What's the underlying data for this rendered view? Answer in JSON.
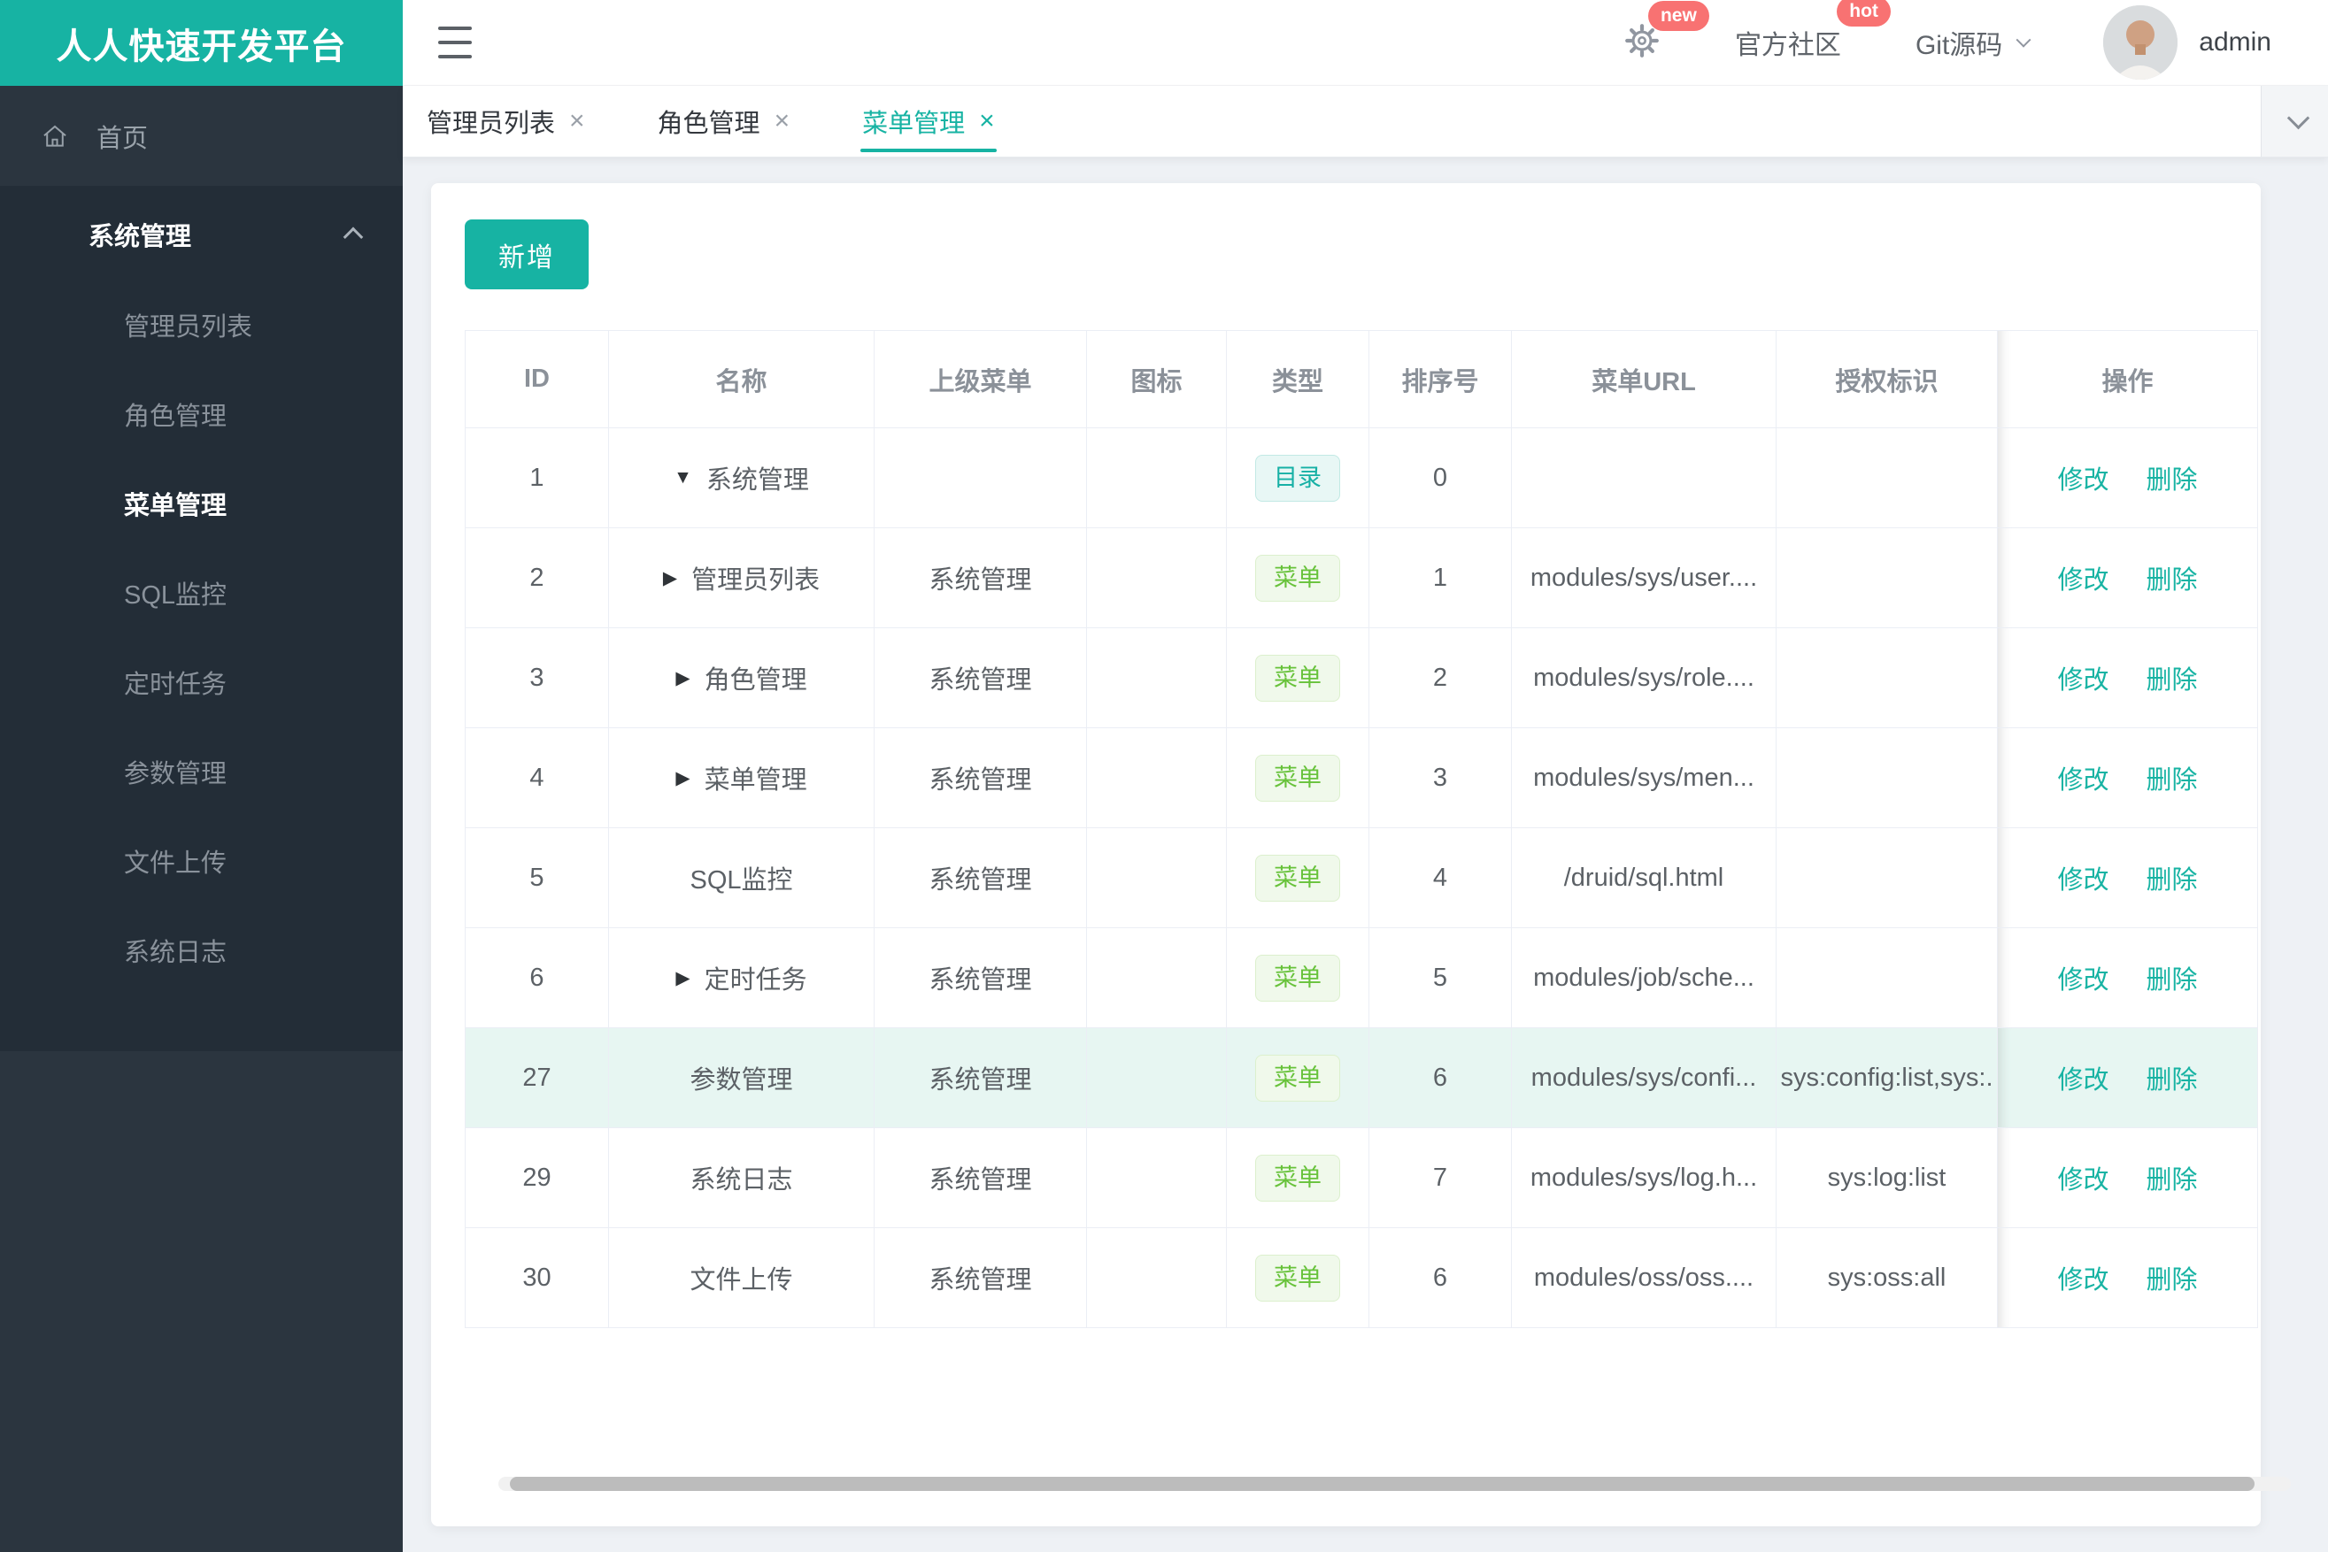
{
  "app": {
    "sidebar_logo": "人人快速开发平台"
  },
  "icons": {
    "close": "×",
    "tree_expanded": "▼",
    "tree_collapsed": "▶"
  },
  "colors": {
    "primary": "#17b3a3",
    "badge_red": "#f87272"
  },
  "sidebar": {
    "home_label": "首页",
    "section_label": "系统管理",
    "items": [
      {
        "label": "管理员列表",
        "active": false
      },
      {
        "label": "角色管理",
        "active": false
      },
      {
        "label": "菜单管理",
        "active": true
      },
      {
        "label": "SQL监控",
        "active": false
      },
      {
        "label": "定时任务",
        "active": false
      },
      {
        "label": "参数管理",
        "active": false
      },
      {
        "label": "文件上传",
        "active": false
      },
      {
        "label": "系统日志",
        "active": false
      }
    ]
  },
  "header": {
    "settings_badge": "new",
    "community_label": "官方社区",
    "community_badge": "hot",
    "git_label": "Git源码",
    "username": "admin"
  },
  "tabs": [
    {
      "label": "管理员列表",
      "active": false
    },
    {
      "label": "角色管理",
      "active": false
    },
    {
      "label": "菜单管理",
      "active": true
    }
  ],
  "toolbar": {
    "add_label": "新增"
  },
  "table": {
    "columns": [
      "ID",
      "名称",
      "上级菜单",
      "图标",
      "类型",
      "排序号",
      "菜单URL",
      "授权标识",
      "操作"
    ],
    "badge_labels": {
      "directory": "目录",
      "menu": "菜单"
    },
    "action_edit": "修改",
    "action_delete": "删除",
    "rows": [
      {
        "id": "1",
        "name": "系统管理",
        "tree": "expanded",
        "parent": "",
        "icon": "",
        "type": "directory",
        "order": "0",
        "url": "",
        "perms": "",
        "highlight": false
      },
      {
        "id": "2",
        "name": "管理员列表",
        "tree": "collapsed",
        "parent": "系统管理",
        "icon": "",
        "type": "menu",
        "order": "1",
        "url": "modules/sys/user....",
        "perms": "",
        "highlight": false
      },
      {
        "id": "3",
        "name": "角色管理",
        "tree": "collapsed",
        "parent": "系统管理",
        "icon": "",
        "type": "menu",
        "order": "2",
        "url": "modules/sys/role....",
        "perms": "",
        "highlight": false
      },
      {
        "id": "4",
        "name": "菜单管理",
        "tree": "collapsed",
        "parent": "系统管理",
        "icon": "",
        "type": "menu",
        "order": "3",
        "url": "modules/sys/men...",
        "perms": "",
        "highlight": false
      },
      {
        "id": "5",
        "name": "SQL监控",
        "tree": "none",
        "parent": "系统管理",
        "icon": "",
        "type": "menu",
        "order": "4",
        "url": "/druid/sql.html",
        "perms": "",
        "highlight": false
      },
      {
        "id": "6",
        "name": "定时任务",
        "tree": "collapsed",
        "parent": "系统管理",
        "icon": "",
        "type": "menu",
        "order": "5",
        "url": "modules/job/sche...",
        "perms": "",
        "highlight": false
      },
      {
        "id": "27",
        "name": "参数管理",
        "tree": "none",
        "parent": "系统管理",
        "icon": "",
        "type": "menu",
        "order": "6",
        "url": "modules/sys/confi...",
        "perms": "sys:config:list,sys:.",
        "highlight": true
      },
      {
        "id": "29",
        "name": "系统日志",
        "tree": "none",
        "parent": "系统管理",
        "icon": "",
        "type": "menu",
        "order": "7",
        "url": "modules/sys/log.h...",
        "perms": "sys:log:list",
        "highlight": false
      },
      {
        "id": "30",
        "name": "文件上传",
        "tree": "none",
        "parent": "系统管理",
        "icon": "",
        "type": "menu",
        "order": "6",
        "url": "modules/oss/oss....",
        "perms": "sys:oss:all",
        "highlight": false
      }
    ]
  }
}
